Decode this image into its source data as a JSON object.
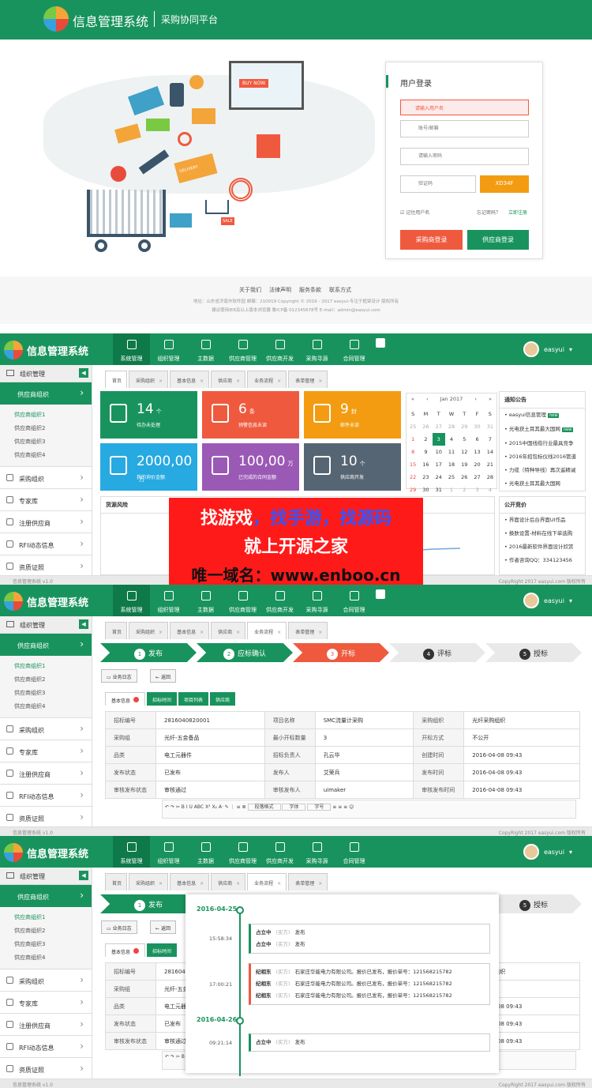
{
  "login": {
    "system_title": "信息管理系统",
    "platform": "采购协同平台",
    "box_title": "用户登录",
    "error": "请输入用户名",
    "account_ph": "账号/邮箱",
    "password_ph": "请输入密码",
    "captcha_ph": "验证码",
    "captcha_code": "XD34F",
    "remember": "记住用户名",
    "forgot": "忘记密码？",
    "register": "立即注册",
    "buyer_login": "采购商登录",
    "supplier_login": "供应商登录",
    "buy_now": "BUY NOW",
    "delivery": "DELIVERY",
    "sale": "SALE",
    "footer_links": [
      "关于我们",
      "法律声明",
      "服务条款",
      "联系方式"
    ],
    "footer_line1": "地址：山东省济南市软件园 邮编：210019  Copyright © 2016 - 2017 easyui-专注于框架设计 版权所有",
    "footer_line2": "建议使用IE8及以上版本浏览器 鲁ICP备 012345678号  E-mail：admin@easyui.com"
  },
  "app": {
    "title": "信息管理系统",
    "nav": [
      "系统管理",
      "组织管理",
      "主数据",
      "供应商管理",
      "供应商开发",
      "采购寻源",
      "合同管理"
    ],
    "user": "easyui",
    "footer_left": "信息管理系统 v1.0",
    "footer_right": "CopyRight 2017  easyui.com 版权所有"
  },
  "sidebar": {
    "head": "组织管理",
    "active": "供应商组织",
    "subs": [
      "供应商组织1",
      "供应商组织2",
      "供应商组织3",
      "供应商组织4"
    ],
    "items": [
      "采购组织",
      "专家库",
      "注册供应商",
      "RFI动态信息",
      "资质证照"
    ]
  },
  "tabs1": [
    "首页",
    "采购组织",
    "基本信息",
    "供应商",
    "业务流程",
    "表单管理"
  ],
  "dashboard": {
    "tiles": [
      {
        "num": "14",
        "unit": "个",
        "label": "待办未处理",
        "color": "#19935d"
      },
      {
        "num": "6",
        "unit": "条",
        "label": "预警信息未读",
        "color": "#ef5a3f"
      },
      {
        "num": "9",
        "unit": "封",
        "label": "邮件未读",
        "color": "#f39c12"
      },
      {
        "num": "2000,00",
        "unit": "万",
        "label": "我的询价金额",
        "color": "#27a9e1"
      },
      {
        "num": "100,00",
        "unit": "万",
        "label": "已完成的合同金额",
        "color": "#9b59b6"
      },
      {
        "num": "10",
        "unit": "个",
        "label": "供应商开发",
        "color": "#566573"
      }
    ],
    "cal_month": "Jan 2017",
    "cal_days": [
      "S",
      "M",
      "T",
      "W",
      "T",
      "F",
      "S"
    ],
    "cal_rows": [
      [
        "25",
        "26",
        "27",
        "28",
        "29",
        "30",
        "31"
      ],
      [
        "1",
        "2",
        "3",
        "4",
        "5",
        "6",
        "7"
      ],
      [
        "8",
        "9",
        "10",
        "11",
        "12",
        "13",
        "14"
      ],
      [
        "15",
        "16",
        "17",
        "18",
        "19",
        "20",
        "21"
      ],
      [
        "22",
        "23",
        "24",
        "25",
        "26",
        "27",
        "28"
      ],
      [
        "29",
        "30",
        "31",
        "1",
        "2",
        "3",
        "4"
      ]
    ],
    "notice_title": "通知公告",
    "notices": [
      "easyui信息管理",
      "光电获土耳其最大国网",
      "2015中国线缆行业最具竞争",
      "2016年招包标仪线2016管道",
      "力缆（特种导线）再次遥精诫",
      "光电获土耳其最大国网"
    ],
    "new_badge": "new",
    "risk_title": "货源风险",
    "bid_title": "公开竞价",
    "bids": [
      "界面设计后台界面UI作品",
      "换肤设置-材料在线下单选购",
      "2016最新软件界面设计欣赏",
      "作者咨询QQ：334123456"
    ]
  },
  "ad": {
    "line1a": "找游戏",
    "line1b": "，找手游，找源码",
    "line2": "就上开源之家",
    "line3": "唯一域名：www.enboo.cn"
  },
  "steps": [
    {
      "n": "1",
      "t": "发布"
    },
    {
      "n": "2",
      "t": "应标确认"
    },
    {
      "n": "3",
      "t": "开标"
    },
    {
      "n": "4",
      "t": "评标"
    },
    {
      "n": "5",
      "t": "授标"
    }
  ],
  "buttons": {
    "log": "业务日志",
    "back": "返回"
  },
  "itabs": [
    "基本信息",
    "招标时间",
    "项目列表",
    "供应商"
  ],
  "detail": [
    [
      "招标编号",
      "2816040820001",
      "项目名称",
      "SMC流量计采购",
      "采购组织",
      "光纤采购组织"
    ],
    [
      "采购组",
      "光纤-五金备品",
      "最小开标数量",
      "3",
      "开标方式",
      "不公开"
    ],
    [
      "品类",
      "电工元器件",
      "招标负责人",
      "孔云华",
      "创建时间",
      "2016-04-08 09:43"
    ],
    [
      "发布状态",
      "已发布",
      "发布人",
      "艾荣兵",
      "发布时间",
      "2016-04-08 09:43"
    ],
    [
      "审核发布状态",
      "审核通过",
      "审核发布人",
      "uimaker",
      "审核发布时间",
      "2016-04-08 09:43"
    ]
  ],
  "editor": {
    "para": "段落格式",
    "font": "字体",
    "size": "字号"
  },
  "timeline": {
    "d1": "2016-04-25",
    "d2": "2016-04-26",
    "entries": [
      {
        "time": "15:58:34",
        "rows": [
          [
            "占立中",
            "(买方)",
            "发布"
          ],
          [
            "占立中",
            "(买方)",
            "发布"
          ]
        ]
      },
      {
        "time": "17:00:21",
        "rows": [
          [
            "纪相东",
            "(买方)",
            "石家庄华能电力有限公司。报价已发布，报价单号：121568215782"
          ],
          [
            "纪相东",
            "(买方)",
            "石家庄华能电力有限公司。报价已发布，报价单号：121568215782"
          ],
          [
            "纪相东",
            "(买方)",
            "石家庄华能电力有限公司。报价已发布，报价单号：121568215782"
          ]
        ]
      },
      {
        "time": "09:21:14",
        "rows": [
          [
            "占立中",
            "(买方)",
            "发布"
          ]
        ]
      }
    ]
  }
}
